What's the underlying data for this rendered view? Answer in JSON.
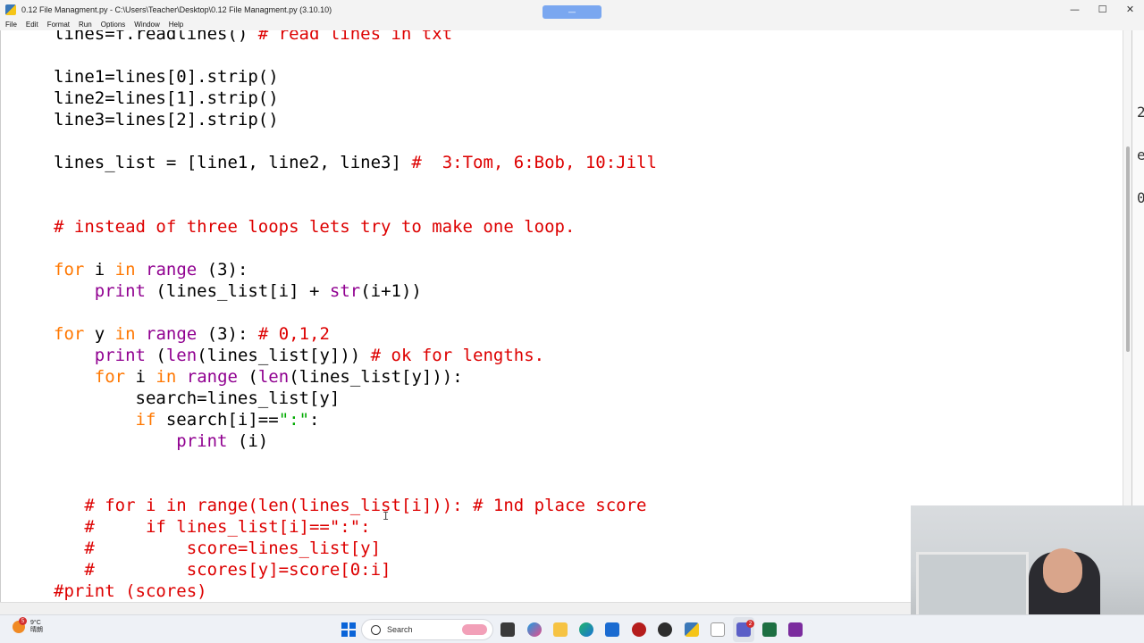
{
  "window": {
    "title": "0.12 File Managment.py - C:\\Users\\Teacher\\Desktop\\0.12 File Managment.py (3.10.10)",
    "pill_label": "—",
    "controls": {
      "minimize": "—",
      "maximize": "☐",
      "close": "✕"
    }
  },
  "menu": [
    "File",
    "Edit",
    "Format",
    "Run",
    "Options",
    "Window",
    "Help"
  ],
  "code_lines": [
    "lines=f.readlines() # read lines in txt",
    "line1=lines[0].strip()",
    "line2=lines[1].strip()",
    "line3=lines[2].strip()",
    "lines_list = [line1, line2, line3] #  3:Tom, 6:Bob, 10:Jill",
    "# instead of three loops lets try to make one loop.",
    "for i in range (3):",
    "    print (lines_list[i] + str(i+1))",
    "for y in range (3): # 0,1,2",
    "    print (len(lines_list[y])) # ok for lengths.",
    "    for i in range (len(lines_list[y])):",
    "        search=lines_list[y]",
    "        if search[i]==\":\":",
    "            print (i)",
    "   # for i in range(len(lines_list[i])): # 1nd place score",
    "   #     if lines_list[i]==\":\":",
    "   #         score=lines_list[y]",
    "   #         scores[y]=score[0:i]",
    "#print (scores)"
  ],
  "cursor_glyph": "I",
  "background_window_chars": [
    "2",
    "e",
    "0"
  ],
  "taskbar": {
    "weather_temp": "9°C",
    "weather_desc": "晴朗",
    "weather_badge": "5",
    "search_placeholder": "Search",
    "teams_badge": "2"
  },
  "colors": {
    "keyword": "#ff7700",
    "builtin": "#900090",
    "comment": "#dd0000",
    "string": "#00aa00",
    "taskbar_bg": "#eef1f6"
  }
}
